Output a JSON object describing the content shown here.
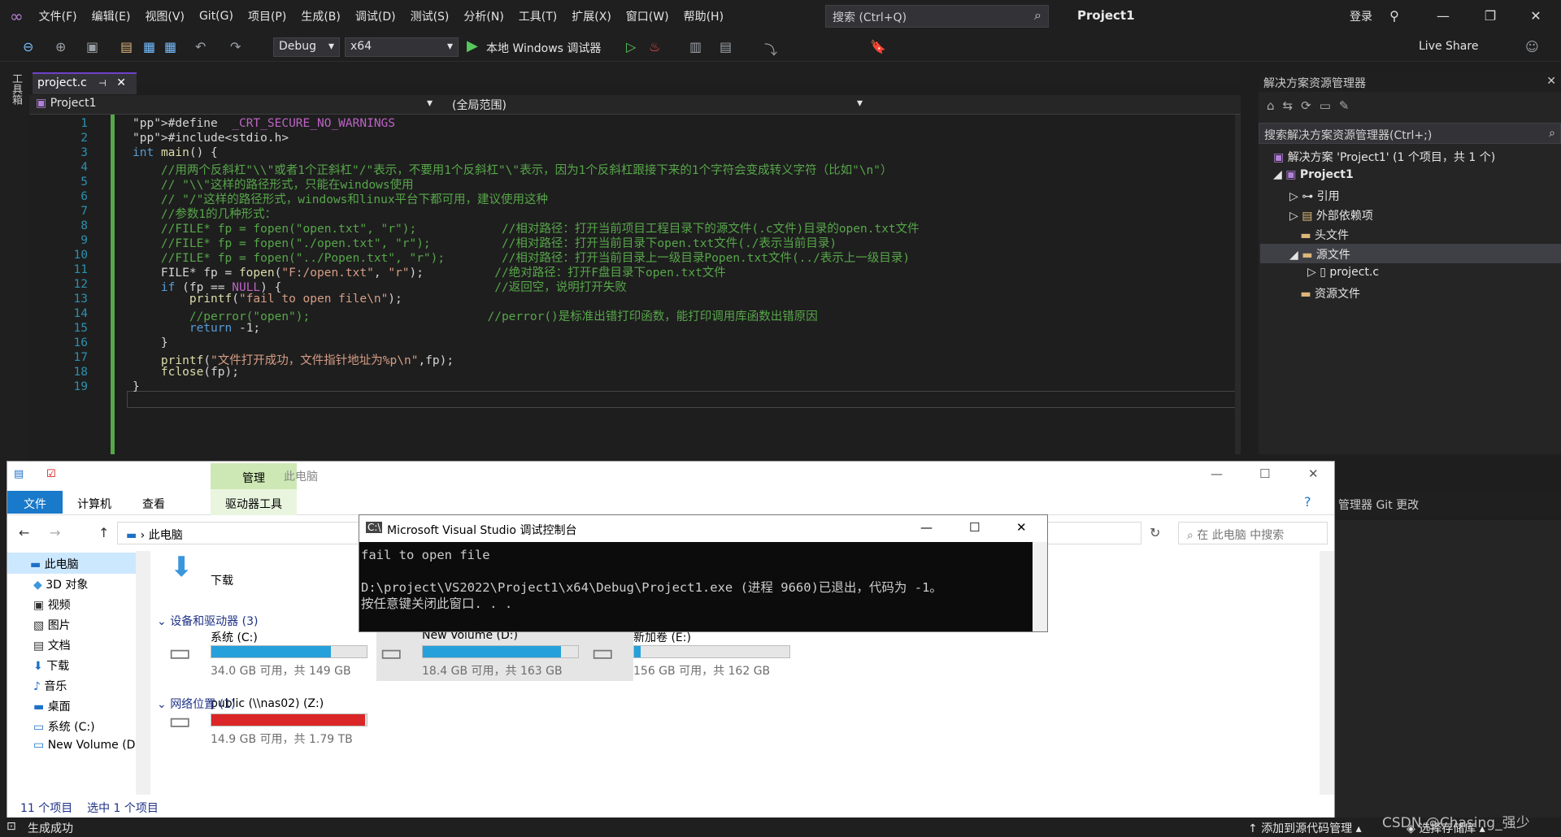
{
  "menu": [
    "文件(F)",
    "编辑(E)",
    "视图(V)",
    "Git(G)",
    "项目(P)",
    "生成(B)",
    "调试(D)",
    "测试(S)",
    "分析(N)",
    "工具(T)",
    "扩展(X)",
    "窗口(W)",
    "帮助(H)"
  ],
  "search_placeholder": "搜索 (Ctrl+Q)",
  "project_title": "Project1",
  "login": "登录",
  "toolbar": {
    "config": "Debug",
    "platform": "x64",
    "run_label": "本地 Windows 调试器",
    "live_share": "Live Share"
  },
  "left_strip_label": "工具箱",
  "tab": {
    "name": "project.c"
  },
  "nav": {
    "project": "Project1",
    "scope": "(全局范围)"
  },
  "code": [
    {
      "n": "1",
      "t": "#define  _CRT_SECURE_NO_WARNINGS"
    },
    {
      "n": "2",
      "t": "#include<stdio.h>"
    },
    {
      "n": "3",
      "t": "int main() {"
    },
    {
      "n": "4",
      "t": "    //用两个反斜杠\"\\\\\"或者1个正斜杠\"/\"表示，不要用1个反斜杠\"\\\"表示，因为1个反斜杠跟接下来的1个字符会变成转义字符（比如\"\\n\"）"
    },
    {
      "n": "5",
      "t": "    // \"\\\\\"这样的路径形式，只能在windows使用"
    },
    {
      "n": "6",
      "t": "    // \"/\"这样的路径形式，windows和linux平台下都可用，建议使用这种"
    },
    {
      "n": "7",
      "t": "    //参数1的几种形式："
    },
    {
      "n": "8",
      "t": "    //FILE* fp = fopen(\"open.txt\", \"r\");            //相对路径：打开当前项目工程目录下的源文件(.c文件)目录的open.txt文件"
    },
    {
      "n": "9",
      "t": "    //FILE* fp = fopen(\"./open.txt\", \"r\");          //相对路径：打开当前目录下open.txt文件(./表示当前目录)"
    },
    {
      "n": "10",
      "t": "    //FILE* fp = fopen(\"../Popen.txt\", \"r\");        //相对路径：打开当前目录上一级目录Popen.txt文件(../表示上一级目录)"
    },
    {
      "n": "11",
      "t": "    FILE* fp = fopen(\"F:/open.txt\", \"r\");          //绝对路径：打开F盘目录下open.txt文件"
    },
    {
      "n": "12",
      "t": "    if (fp == NULL) {                              //返回空，说明打开失败"
    },
    {
      "n": "13",
      "t": "        printf(\"fail to open file\\n\");"
    },
    {
      "n": "14",
      "t": "        //perror(\"open\");                         //perror()是标准出错打印函数，能打印调用库函数出错原因"
    },
    {
      "n": "15",
      "t": "        return -1;"
    },
    {
      "n": "16",
      "t": "    }"
    },
    {
      "n": "17",
      "t": "    printf(\"文件打开成功，文件指针地址为%p\\n\",fp);"
    },
    {
      "n": "18",
      "t": "    fclose(fp);"
    },
    {
      "n": "19",
      "t": "}"
    }
  ],
  "solution_explorer": {
    "title": "解决方案资源管理器",
    "search": "搜索解决方案资源管理器(Ctrl+;)",
    "items": [
      "解决方案 'Project1' (1 个项目，共 1 个)",
      "Project1",
      "引用",
      "外部依赖项",
      "头文件",
      "源文件",
      "project.c",
      "资源文件"
    ]
  },
  "explorer": {
    "title": "此电脑",
    "ribbon_manage": "管理",
    "ribbon_tabs": [
      "文件",
      "计算机",
      "查看",
      "驱动器工具"
    ],
    "path": "此电脑",
    "search": "在 此电脑 中搜索",
    "nav_items": [
      "此电脑",
      "3D 对象",
      "视频",
      "图片",
      "文档",
      "下载",
      "音乐",
      "桌面",
      "系统 (C:)",
      "New Volume (D:)"
    ],
    "download_label": "下载",
    "section_devices": "设备和驱动器 (3)",
    "section_network": "网络位置 (1)",
    "drives": [
      {
        "name": "系统 (C:)",
        "info": "34.0 GB 可用，共 149 GB",
        "used": 0.77
      },
      {
        "name": "New Volume (D:)",
        "info": "18.4 GB 可用，共 163 GB",
        "used": 0.89
      },
      {
        "name": "新加卷 (E:)",
        "info": "156 GB 可用，共 162 GB",
        "used": 0.04
      },
      {
        "name": "public (\\\\nas02) (Z:)",
        "info": "14.9 GB 可用，共 1.79 TB",
        "used": 0.99
      }
    ],
    "status_count": "11 个项目",
    "status_sel": "选中 1 个项目",
    "right_tabs": "管理器   Git 更改"
  },
  "console": {
    "title": "Microsoft Visual Studio 调试控制台",
    "lines": "fail to open file\n\nD:\\project\\VS2022\\Project1\\x64\\Debug\\Project1.exe (进程 9660)已退出，代码为 -1。\n按任意键关闭此窗口. . ."
  },
  "status": {
    "left": "生成成功",
    "source_ctrl": "添加到源代码管理",
    "repo": "选择存储库",
    "watermark": "CSDN @Chasing_强少"
  }
}
